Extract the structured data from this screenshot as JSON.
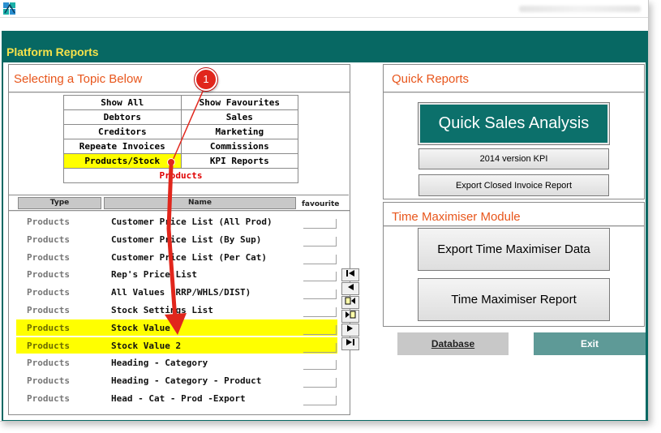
{
  "window": {
    "app_title": "Platform Reports"
  },
  "left_panel": {
    "title": "Selecting a Topic Below",
    "topics": [
      [
        "Show All",
        "Show Favourites"
      ],
      [
        "Debtors",
        "Sales"
      ],
      [
        "Creditors",
        "Marketing"
      ],
      [
        "Repeate Invoices",
        "Commissions"
      ],
      [
        "Products/Stock",
        "KPI Reports"
      ]
    ],
    "active_topic": "Products",
    "columns": {
      "type": "Type",
      "name": "Name",
      "favourite": "favourite"
    },
    "rows": [
      {
        "type": "Products",
        "name": "Customer Price List (All Prod)"
      },
      {
        "type": "Products",
        "name": "Customer Price List (By Sup)"
      },
      {
        "type": "Products",
        "name": "Customer Price List (Per Cat)"
      },
      {
        "type": "Products",
        "name": "Rep's Price List"
      },
      {
        "type": "Products",
        "name": "All Values (RRP/WHLS/DIST)"
      },
      {
        "type": "Products",
        "name": "Stock Settings List"
      },
      {
        "type": "Products",
        "name": "Stock Value"
      },
      {
        "type": "Products",
        "name": "Stock Value 2"
      },
      {
        "type": "Products",
        "name": "Heading - Category"
      },
      {
        "type": "Products",
        "name": "Heading - Category - Product"
      },
      {
        "type": "Products",
        "name": "Head - Cat - Prod -Export"
      }
    ],
    "nav_buttons": [
      "first-record-icon",
      "previous-record-icon",
      "new-record-icon",
      "copy-record-icon",
      "next-record-icon",
      "last-record-icon"
    ]
  },
  "quick_reports": {
    "title": "Quick Reports",
    "quick_sales": "Quick Sales Analysis",
    "kpi_2014": "2014 version KPI",
    "export_closed": "Export Closed Invoice Report"
  },
  "time_maximiser": {
    "title": "Time Maximiser Module",
    "export_data": "Export Time Maximiser Data",
    "report": "Time Maximiser Report"
  },
  "footer": {
    "database": "Database",
    "exit": "Exit"
  },
  "callout": {
    "number": "1"
  },
  "colors": {
    "teal": "#076863",
    "title_yellow": "#f6e24a",
    "panel_title": "#e8561c",
    "highlight": "#ffff00",
    "annotation_red": "#e1261c"
  }
}
